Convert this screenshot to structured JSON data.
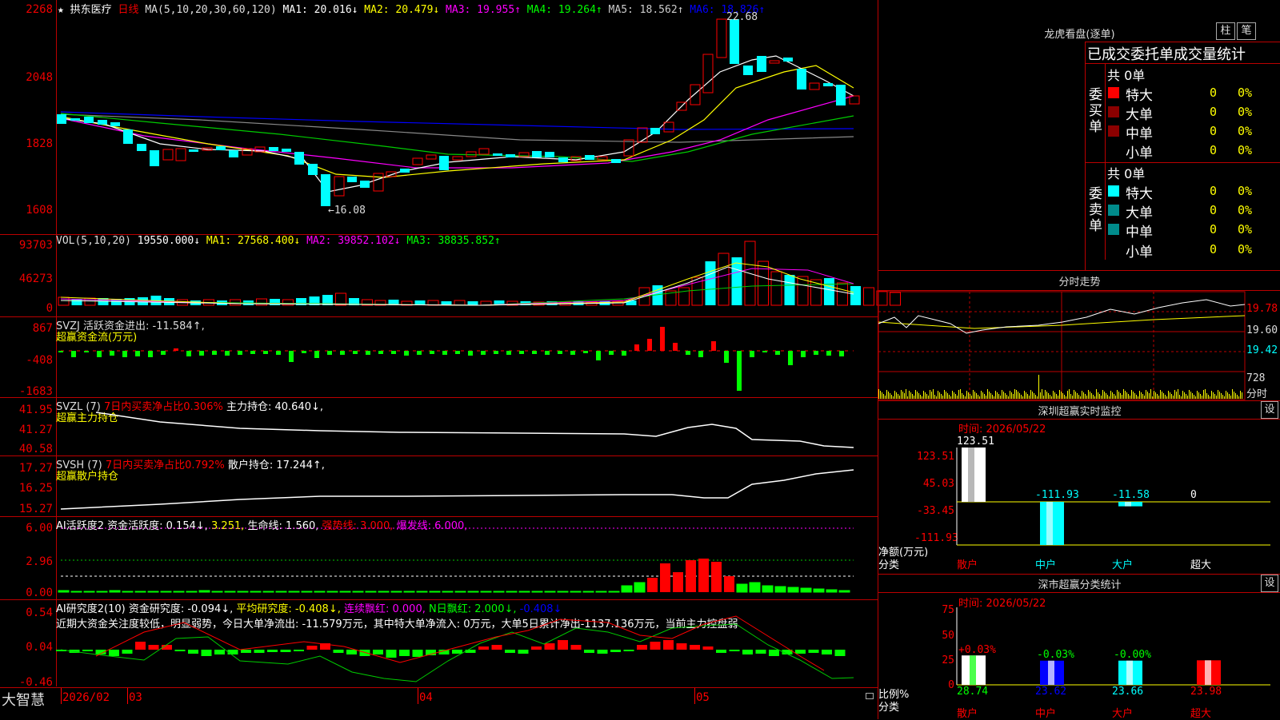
{
  "stock": {
    "star": "★",
    "name": "拱东医疗",
    "period": "日线"
  },
  "k": {
    "ma_text": "MA(5,10,20,30,60,120)",
    "ma1": "MA1: 20.016↓",
    "ma2": "MA2: 20.479↓",
    "ma3": "MA3: 19.955↑",
    "ma4": "MA4: 19.264↑",
    "ma5": "MA5: 18.562↑",
    "ma6": "MA6: 18.826↑",
    "y_labels": [
      "2268",
      "2048",
      "1828",
      "1608"
    ],
    "high_mark": "22.68",
    "low_mark": "←16.08"
  },
  "vol": {
    "title": "VOL(5,10,20)",
    "value": "19550.000↓",
    "ma1": "MA1: 27568.400↓",
    "ma2": "MA2: 39852.102↓",
    "ma3": "MA3: 38835.852↑",
    "y_labels": [
      "93703",
      "46273",
      "0"
    ]
  },
  "svzj": {
    "title": "SVZJ  活跃资金进出: -11.584↑,",
    "sub": "超赢资金流(万元)",
    "y_labels": [
      "867",
      "-408",
      "-1683"
    ]
  },
  "svzl": {
    "title": "SVZL (7)",
    "red": "7日内买卖净占比0.306%",
    "rest": "主力持仓: 40.640↓,",
    "sub": "超赢主力持仓",
    "y_labels": [
      "41.95",
      "41.27",
      "40.58"
    ]
  },
  "svsh": {
    "title": "SVSH (7)",
    "red": "7日内买卖净占比0.792%",
    "rest": "散户持仓: 17.244↑,",
    "sub": "超赢散户持仓",
    "y_labels": [
      "17.27",
      "16.25",
      "15.27"
    ]
  },
  "ai1": {
    "title": "AI活跃度2 资金活跃度: 0.154↓,",
    "v2": "3.251,",
    "life": "生命线: 1.560,",
    "strong": "强势线: 3.000,",
    "burst": "爆发线: 6.000,",
    "y_labels": [
      "6.00",
      "2.96",
      "0.00"
    ]
  },
  "ai2": {
    "title": "AI研究度2(10) 资金研究度: -0.094↓,",
    "avg": "平均研究度: -0.408↓,",
    "red": "连续飘红: 0.000,",
    "nred": "N日飘红: 2.000↓,",
    "last": "-0.408↓",
    "comment": "近期大资金关注度较低，明显弱势，今日大单净流出: -11.579万元，其中特大单净流入: 0万元，大单5日累计净出-1137.136万元，当前主力控盘弱",
    "y_labels": [
      "0.54",
      "0.04",
      "-0.46"
    ]
  },
  "xaxis": {
    "brand": "大智慧",
    "labels": [
      "2026/02",
      "03",
      "04",
      "05"
    ]
  },
  "longhu": {
    "title": "龙虎看盘(逐单)",
    "btn1": "柱",
    "btn2": "笔",
    "header": "已成交委托单成交量统计",
    "buy": {
      "side": "委买单",
      "total": "共 0单",
      "rows": [
        {
          "name": "特大",
          "v": "0",
          "p": "0%"
        },
        {
          "name": "大单",
          "v": "0",
          "p": "0%"
        },
        {
          "name": "中单",
          "v": "0",
          "p": "0%"
        },
        {
          "name": "小单",
          "v": "0",
          "p": "0%"
        }
      ]
    },
    "sell": {
      "side": "委卖单",
      "total": "共 0单",
      "rows": [
        {
          "name": "特大",
          "v": "0",
          "p": "0%"
        },
        {
          "name": "大单",
          "v": "0",
          "p": "0%"
        },
        {
          "name": "中单",
          "v": "0",
          "p": "0%"
        },
        {
          "name": "小单",
          "v": "0",
          "p": "0%"
        }
      ]
    },
    "colors": {
      "buy_special": "#ff0000",
      "buy_other": "#8b0000",
      "sell_special": "#00ffff",
      "sell_other": "#008b8b"
    }
  },
  "fenshi": {
    "title": "分时走势",
    "price_labels": [
      "19.78",
      "19.60",
      "19.42"
    ],
    "vol_labels": [
      "728",
      "分时"
    ]
  },
  "monitor": {
    "title": "深圳超赢实时监控",
    "set": "设",
    "time": "时间: 2026/05/22",
    "y_labels": [
      "123.51",
      "45.03",
      "-33.45",
      "-111.93"
    ],
    "values": [
      "123.51",
      "-111.93",
      "-11.58",
      "0"
    ],
    "cats": [
      "散户",
      "中户",
      "大户",
      "超大"
    ],
    "axis_title": "净额(万元)",
    "axis_cat": "分类"
  },
  "classify": {
    "title": "深市超赢分类统计",
    "set": "设",
    "time": "时间: 2026/05/22",
    "y_labels": [
      "75",
      "50",
      "25",
      "0"
    ],
    "pct_labels": [
      "+0.03%",
      "-0.03%",
      "-0.00%"
    ],
    "values": [
      "28.74",
      "23.62",
      "23.66",
      "23.98"
    ],
    "cats": [
      "散户",
      "中户",
      "大户",
      "超大"
    ],
    "axis_title": "比例%",
    "axis_cat": "分类"
  },
  "chart_data": {
    "type": "bar",
    "title": "深圳超赢实时监控",
    "ylabel": "净额(万元)",
    "categories": [
      "散户",
      "中户",
      "大户",
      "超大"
    ],
    "values": [
      123.51,
      -111.93,
      -11.58,
      0
    ],
    "ylim": [
      -111.93,
      123.51
    ]
  }
}
